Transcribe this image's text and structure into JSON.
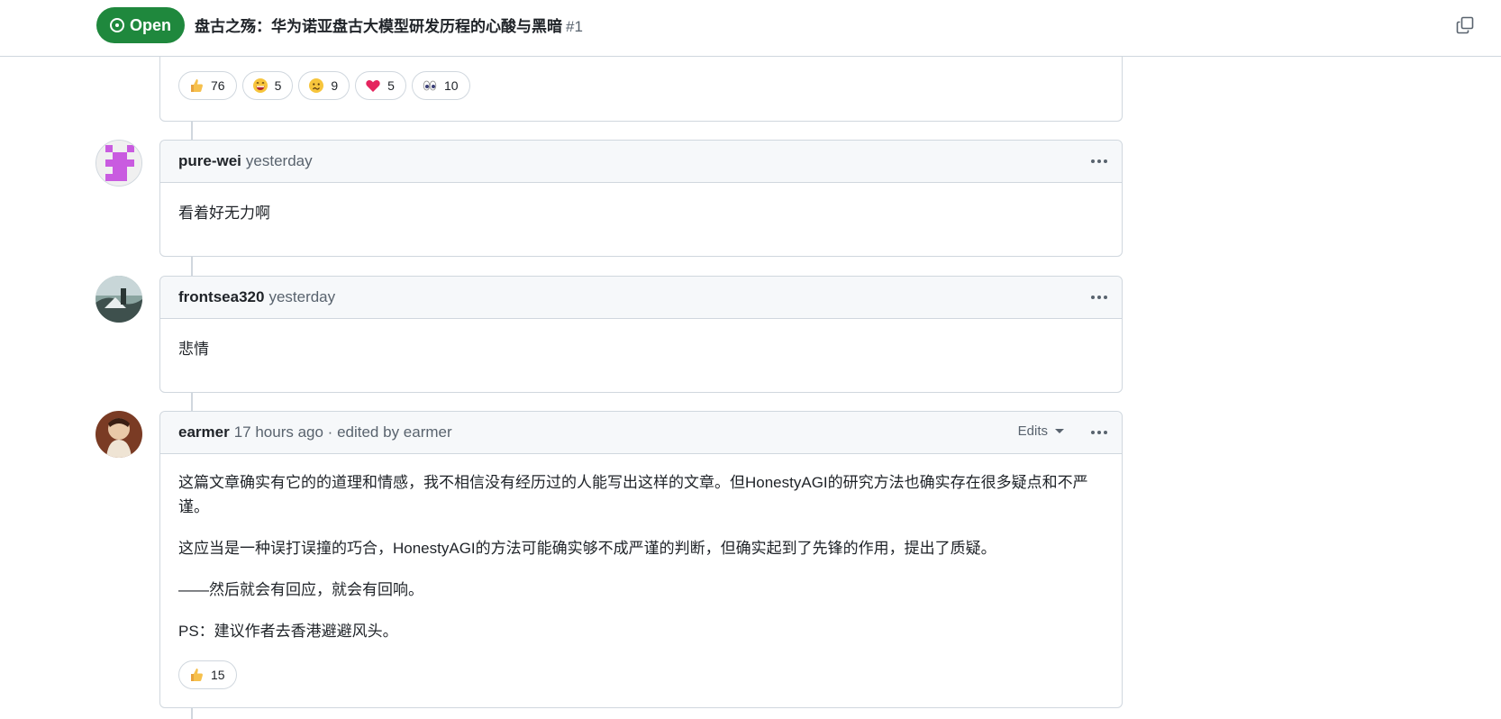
{
  "header": {
    "state_label": "Open",
    "title": "盘古之殇：华为诺亚盘古大模型研发历程的心酸与黑暗",
    "issue_number": "#1"
  },
  "top_reactions": [
    {
      "emoji": "thumbs-up",
      "count": "76"
    },
    {
      "emoji": "laugh",
      "count": "5"
    },
    {
      "emoji": "confused",
      "count": "9"
    },
    {
      "emoji": "heart",
      "count": "5"
    },
    {
      "emoji": "eyes",
      "count": "10"
    }
  ],
  "comments": [
    {
      "author": "pure-wei",
      "meta": "yesterday",
      "body": [
        "看着好无力啊"
      ]
    },
    {
      "author": "frontsea320",
      "meta": "yesterday",
      "body": [
        "悲情"
      ]
    },
    {
      "author": "earmer",
      "meta": "17 hours ago · edited by earmer",
      "edits_label": "Edits",
      "body": [
        "这篇文章确实有它的的道理和情感，我不相信没有经历过的人能写出这样的文章。但HonestyAGI的研究方法也确实存在很多疑点和不严谨。",
        "这应当是一种误打误撞的巧合，HonestyAGI的方法可能确实够不成严谨的判断，但确实起到了先锋的作用，提出了质疑。",
        "——然后就会有回应，就会有回响。",
        "PS：建议作者去香港避避风头。"
      ],
      "reactions": [
        {
          "emoji": "thumbs-up",
          "count": "15"
        }
      ]
    }
  ],
  "colors": {
    "open_green": "#1f883d",
    "border": "#d0d7de",
    "header_bg": "#f6f8fa",
    "muted_text": "#59636e"
  }
}
